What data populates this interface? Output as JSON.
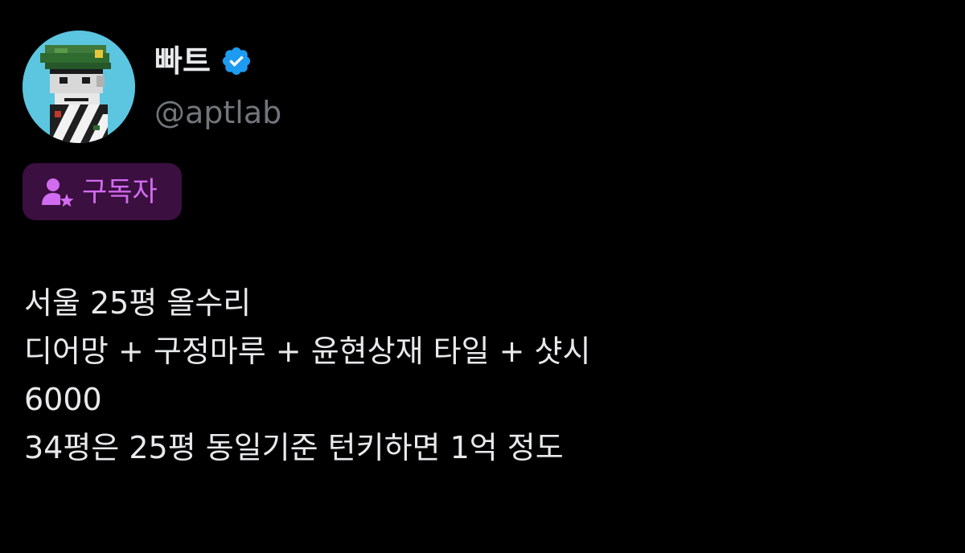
{
  "author": {
    "display_name": "빠트",
    "handle": "@aptlab",
    "verified_icon": "verified-badge-icon",
    "avatar_icon": "pixel-art-avatar",
    "colors": {
      "verified": "#1d9bf0",
      "handle": "#71767b",
      "avatar_bg": "#5cc5e0"
    }
  },
  "subscriber_badge": {
    "label": "구독자",
    "icon": "subscriber-person-star-icon",
    "colors": {
      "background": "#3b0f3f",
      "text": "#d16bf0"
    }
  },
  "tweet": {
    "lines": [
      "서울 25평 올수리",
      "디어망 + 구정마루 + 윤현상재 타일 + 샷시",
      "6000",
      "34평은 25평 동일기준 턴키하면 1억 정도"
    ]
  },
  "theme": {
    "background": "#000000",
    "text": "#e7e9ea"
  }
}
